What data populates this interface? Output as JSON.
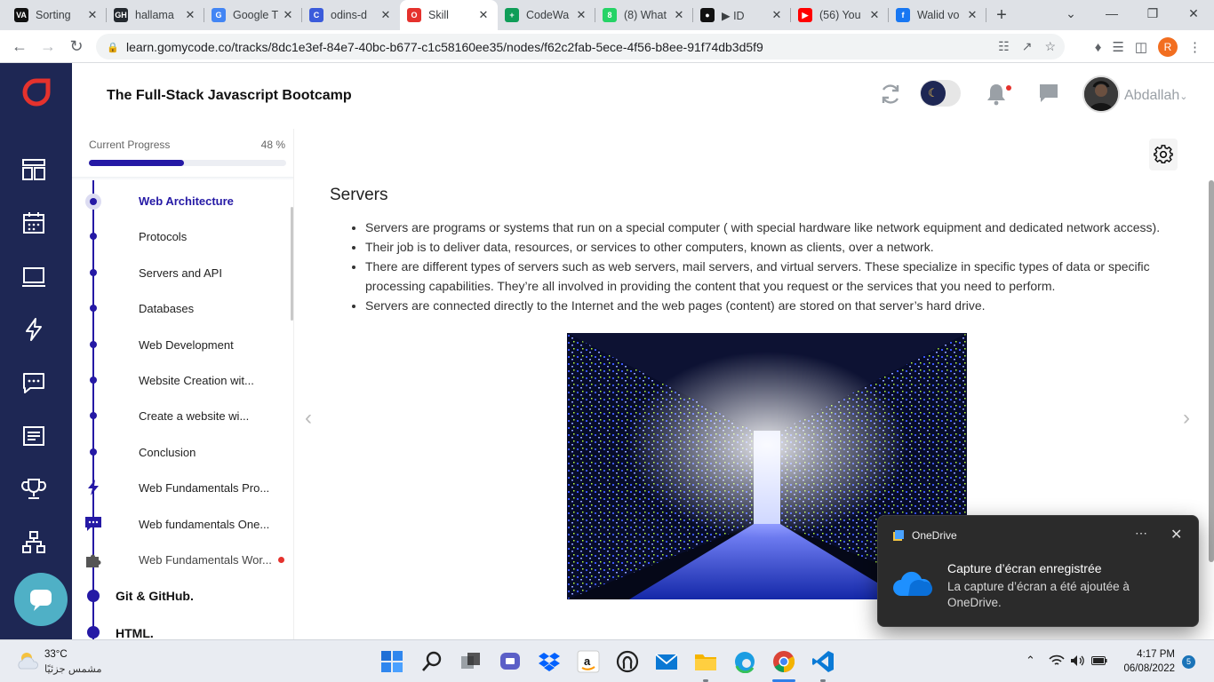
{
  "browser": {
    "tabs": [
      {
        "title": "Sorting",
        "color": "#111111",
        "glyph": "VA"
      },
      {
        "title": "hallama",
        "color": "#24292f",
        "glyph": "GH"
      },
      {
        "title": "Google T",
        "color": "#4285f4",
        "glyph": "G"
      },
      {
        "title": "odins-d",
        "color": "#3b5bdb",
        "glyph": "C"
      },
      {
        "title": "Skill",
        "color": "#e5322d",
        "glyph": "O"
      },
      {
        "title": "CodeWa",
        "color": "#0f9d58",
        "glyph": "+"
      },
      {
        "title": "(8) What",
        "color": "#25d366",
        "glyph": "8"
      },
      {
        "title": "▶ ID",
        "color": "#111111",
        "glyph": "●"
      },
      {
        "title": "(56) You",
        "color": "#ff0000",
        "glyph": "▶"
      },
      {
        "title": "Walid vo",
        "color": "#1877f2",
        "glyph": "f"
      }
    ],
    "url": "learn.gomycode.co/tracks/8dc1e3ef-84e7-40bc-b677-c1c58160ee35/nodes/f62c2fab-5ece-4f56-b8ee-91f74db3d5f9",
    "profile_initial": "R"
  },
  "header": {
    "course_title": "The Full-Stack Javascript Bootcamp",
    "username": "Abdallah"
  },
  "progress": {
    "label": "Current Progress",
    "value_text": "48 %",
    "fraction": 0.48
  },
  "sidebar": {
    "items": [
      {
        "label": "Web Architecture"
      },
      {
        "label": "Protocols"
      },
      {
        "label": "Servers and API"
      },
      {
        "label": "Databases"
      },
      {
        "label": "Web Development"
      },
      {
        "label": "Website Creation wit..."
      },
      {
        "label": "Create a website wi..."
      },
      {
        "label": "Conclusion"
      },
      {
        "label": "Web Fundamentals Pro..."
      },
      {
        "label": "Web fundamentals One..."
      },
      {
        "label": "Web Fundamentals Wor..."
      },
      {
        "label": "Git & GitHub."
      },
      {
        "label": "HTML."
      }
    ]
  },
  "lesson": {
    "title": "Servers",
    "bullets": [
      "Servers are programs or systems that run on a special computer ( with special hardware like network equipment and dedicated network access).",
      "Their job is to deliver data, resources, or services to other computers, known as clients, over a network.",
      "There are different types of servers such as web servers, mail servers, and virtual servers. These specialize in specific types of data or specific processing capabilities. They’re all involved in providing the content that you request or the services that you need to perform.",
      "Servers are connected directly to the Internet and the web pages (content) are stored on that server’s hard drive."
    ]
  },
  "toast": {
    "app": "OneDrive",
    "heading": "Capture d’écran enregistrée",
    "body": "La capture d’écran a été ajoutée à OneDrive."
  },
  "taskbar": {
    "temperature": "33°C",
    "weather_desc": "مشمس جزئيًا",
    "time": "4:17 PM",
    "date": "06/08/2022",
    "notifications": "5"
  },
  "colors": {
    "brand_dark": "#1e2754",
    "accent": "#2519a5",
    "logo_red": "#e5322d"
  }
}
